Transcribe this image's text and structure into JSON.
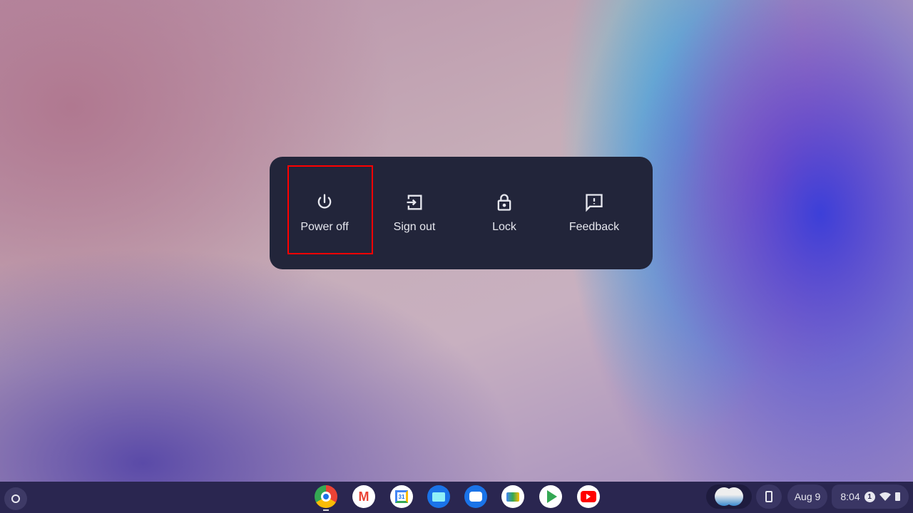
{
  "power_menu": {
    "items": [
      {
        "label": "Power off",
        "icon": "power-icon"
      },
      {
        "label": "Sign out",
        "icon": "sign-out-icon"
      },
      {
        "label": "Lock",
        "icon": "lock-icon"
      },
      {
        "label": "Feedback",
        "icon": "feedback-icon"
      }
    ]
  },
  "shelf": {
    "apps": [
      "Chrome",
      "Gmail",
      "Calendar",
      "Files",
      "Messages",
      "Meet",
      "Play Store",
      "YouTube"
    ],
    "calendar_day": "31",
    "date": "Aug 9",
    "time": "8:04",
    "notification_count": "1"
  },
  "colors": {
    "highlight": "#ff0000",
    "menu_bg": "#22253a"
  }
}
